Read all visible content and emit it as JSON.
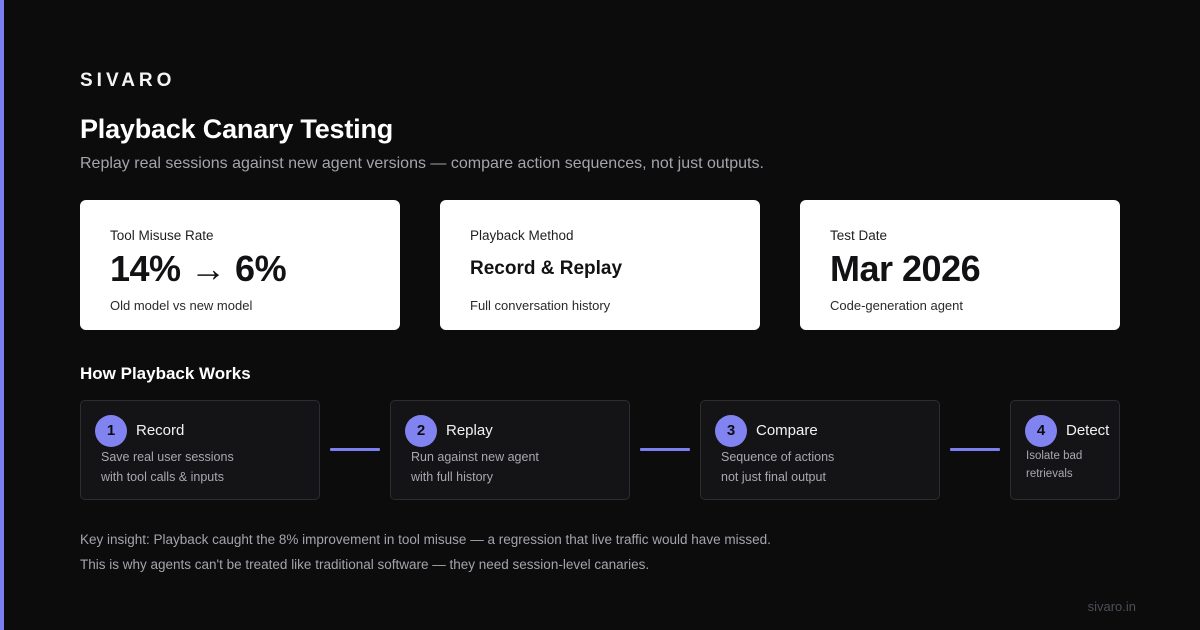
{
  "brand": "SIVARO",
  "title": "Playback Canary Testing",
  "subtitle": "Replay real sessions against new agent versions — compare action sequences, not just outputs.",
  "cards": [
    {
      "label": "Tool Misuse Rate",
      "value": "14% → 6%",
      "note": "Old model vs new model"
    },
    {
      "label": "Playback Method",
      "value": "Record & Replay",
      "note": "Full conversation history"
    },
    {
      "label": "Test Date",
      "value": "Mar 2026",
      "note": "Code-generation agent"
    }
  ],
  "section_title": "How Playback Works",
  "steps": [
    {
      "num": "1",
      "title": "Record",
      "line1": "Save real user sessions",
      "line2": "with tool calls & inputs"
    },
    {
      "num": "2",
      "title": "Replay",
      "line1": "Run against new agent",
      "line2": "with full history"
    },
    {
      "num": "3",
      "title": "Compare",
      "line1": "Sequence of actions",
      "line2": "not just final output"
    },
    {
      "num": "4",
      "title": "Detect",
      "line1": "Isolate bad",
      "line2": "retrievals"
    }
  ],
  "insight": {
    "line1": "Key insight: Playback caught the 8% improvement in tool misuse — a regression that live traffic would have missed.",
    "line2": "This is why agents can't be treated like traditional software — they need session-level canaries."
  },
  "footer": "sivaro.in",
  "colors": {
    "accent": "#7c7ff0",
    "step_badge": "#8184f0",
    "background": "#0c0c0d",
    "card": "#ffffff"
  }
}
